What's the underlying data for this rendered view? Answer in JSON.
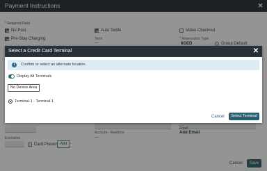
{
  "background": {
    "title": "Payment Instructions",
    "required_label": "* Required Field",
    "checkboxes": [
      {
        "label": "No Post",
        "checked": true
      },
      {
        "label": "Pre-Stay Charging",
        "checked": true
      },
      {
        "label": "Auto Settle",
        "checked": true
      },
      {
        "label": "Video Checkout",
        "checked": false
      }
    ],
    "term_label": "Term",
    "term_value": "—",
    "reservation_type_label": "* Reservation Type",
    "reservation_type_value": "6GED",
    "group_default_label": "Group Default",
    "account_label": "Account - Resident",
    "account_value": "—",
    "email_label": "Email",
    "add_email": "Add Email",
    "expiration_label": "Expiration",
    "card_present_label": "Card Present",
    "add_button": "Add",
    "cancel": "Cancel",
    "save": "Save"
  },
  "modal": {
    "title": "Select a Credit Card Terminal",
    "info_text": "Confirm or select an alternate location",
    "toggle_label": "Display All Terminals",
    "toggle_on": true,
    "area_card": "No Device Area",
    "terminal_option": "Terminal-1 - Terminal-1",
    "cancel": "Cancel",
    "select": "Select Terminal"
  }
}
